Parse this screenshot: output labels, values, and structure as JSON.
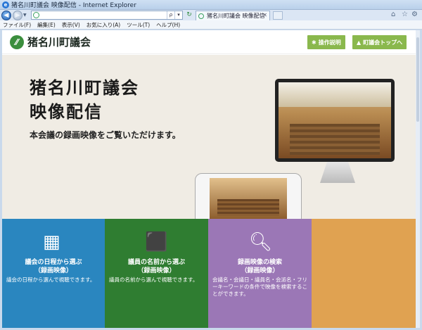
{
  "browser": {
    "window_title": "猪名川町議会 映像配信 - Internet Explorer",
    "tab_title": "猪名川町議会 映像配信",
    "menu": [
      "ファイル(F)",
      "編集(E)",
      "表示(V)",
      "お気に入り(A)",
      "ツール(T)",
      "ヘルプ(H)"
    ]
  },
  "header": {
    "site_name": "猪名川町議会",
    "buttons": [
      {
        "label": "操作説明",
        "icon": "gear-icon"
      },
      {
        "label": "町議会トップへ",
        "icon": "home-icon"
      }
    ]
  },
  "hero": {
    "title_line1": "猪名川町議会",
    "title_line2": "映像配信",
    "subtitle": "本会議の録画映像をご覧いただけます。"
  },
  "tiles": [
    {
      "icon": "calendar-icon",
      "title_line1": "議会の日程から選ぶ",
      "title_line2": "（録画映像）",
      "desc": "議会の日程から選んで視聴できます。",
      "color": "#2a86bf"
    },
    {
      "icon": "speaker-podium-icon",
      "title_line1": "議員の名前から選ぶ",
      "title_line2": "（録画映像）",
      "desc": "議員の名前から選んで視聴できます。",
      "color": "#2f7d31"
    },
    {
      "icon": "search-icon",
      "title_line1": "録画映像の検索",
      "title_line2": "（録画映像）",
      "desc": "会議名・会議日・議員名・会派名・フリーキーワードの条件で映像を検索することができます。",
      "color": "#9b77b6"
    },
    {
      "color": "#e0a251"
    }
  ]
}
